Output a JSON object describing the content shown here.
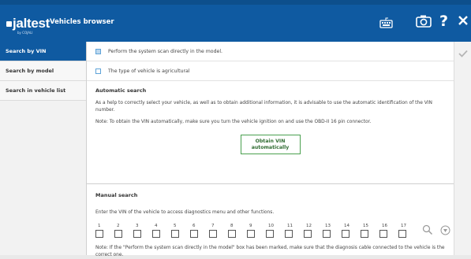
{
  "app": {
    "logo_text": "jaltest",
    "logo_sub": "by COJALI",
    "title": "Vehicles browser"
  },
  "top_icons": [
    "keyboard-icon",
    "camera-icon",
    "help-icon",
    "close-icon"
  ],
  "sidebar": {
    "items": [
      {
        "label": "Search by VIN",
        "active": true
      },
      {
        "label": "Search by model",
        "active": false
      },
      {
        "label": "Search in vehicle list",
        "active": false
      }
    ]
  },
  "options": [
    {
      "label": "Perform the system scan directly in the model.",
      "checked": true
    },
    {
      "label": "The type of vehicle is agricultural",
      "checked": false
    }
  ],
  "automatic": {
    "title": "Automatic search",
    "text1": "As a help to correctly select your vehicle, as well as to obtain additional information, it is advisable to use the automatic identification of the VIN number.",
    "text2": "Note: To obtain the VIN automatically, make sure you turn the vehicle ignition on and use the OBD-II 16 pin connector.",
    "button_line1": "Obtain VIN",
    "button_line2": "automatically"
  },
  "manual": {
    "title": "Manual search",
    "text": "Enter the VIN of the vehicle to access diagnostics menu and other functions.",
    "positions": [
      "1",
      "2",
      "3",
      "4",
      "5",
      "6",
      "7",
      "8",
      "9",
      "10",
      "11",
      "12",
      "13",
      "14",
      "15",
      "16",
      "17"
    ],
    "note": "Note: If the \"Perform the system scan directly in the model\" box has been marked, make sure that the diagnosis cable connected to the vehicle is the correct one."
  },
  "colors": {
    "brand": "#0f5aa1",
    "accent_green": "#4aa04f",
    "checkbox": "#5fa3d8"
  }
}
